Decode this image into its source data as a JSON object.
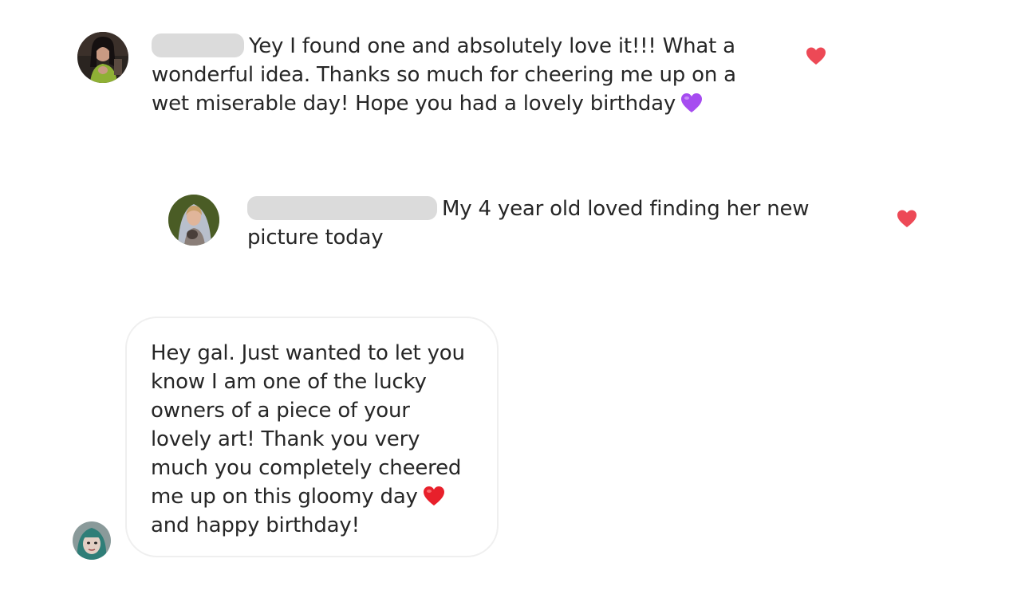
{
  "comments": [
    {
      "text": "Yey I found one and absolutely love it!!! What a wonderful idea. Thanks so much for cheering me up on a wet miserable day! Hope you had a lovely birthday",
      "emoji": "purple-heart-emoji",
      "liked_icon": "heart-icon",
      "username_hidden": true
    },
    {
      "text": "My 4 year old loved finding her new picture today",
      "liked_icon": "heart-icon",
      "username_hidden": true
    }
  ],
  "message": {
    "text_before_emoji": "Hey gal. Just wanted to let you\nknow I am one of the lucky\nowners of a piece of your\nlovely art! Thank you very\nmuch you completely cheered\nme up on this gloomy day",
    "emoji": "red-heart-emoji",
    "text_after_emoji": "and happy birthday!"
  },
  "colors": {
    "like_heart": "#ed4956",
    "purple_heart": "#a64cf0",
    "red_heart": "#e8202b",
    "redaction": "#dbdbdb",
    "bubble_border": "#efefef",
    "text": "#262626"
  }
}
